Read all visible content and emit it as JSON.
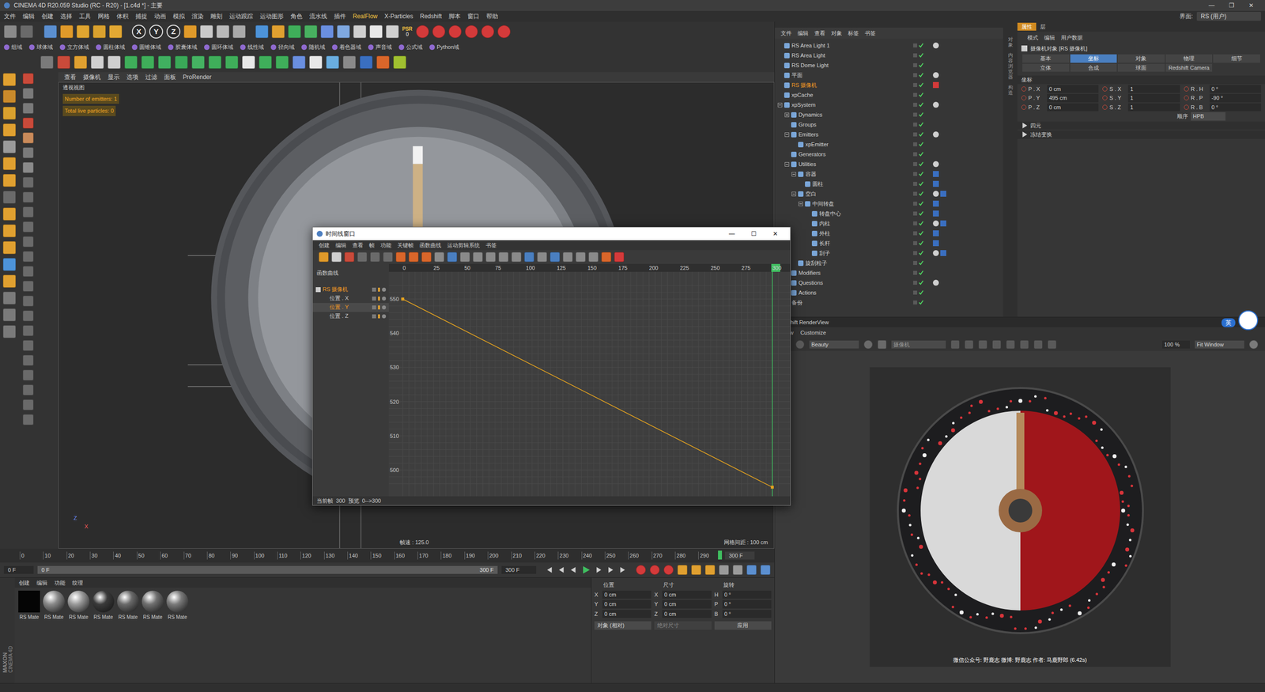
{
  "window": {
    "title": "CINEMA 4D R20.059 Studio (RC - R20) - [1.c4d *] - 主要",
    "controls": [
      "—",
      "❐",
      "✕"
    ]
  },
  "menu": [
    {
      "label": "文件",
      "highlighted": false
    },
    {
      "label": "编辑",
      "highlighted": false
    },
    {
      "label": "创建",
      "highlighted": false
    },
    {
      "label": "选择",
      "highlighted": false
    },
    {
      "label": "工具",
      "highlighted": false
    },
    {
      "label": "网格",
      "highlighted": false
    },
    {
      "label": "体积",
      "highlighted": false
    },
    {
      "label": "捕捉",
      "highlighted": false
    },
    {
      "label": "动画",
      "highlighted": false
    },
    {
      "label": "模拟",
      "highlighted": false
    },
    {
      "label": "渲染",
      "highlighted": false
    },
    {
      "label": "雕刻",
      "highlighted": false
    },
    {
      "label": "运动跟踪",
      "highlighted": false
    },
    {
      "label": "运动图形",
      "highlighted": false
    },
    {
      "label": "角色",
      "highlighted": false
    },
    {
      "label": "流水线",
      "highlighted": false
    },
    {
      "label": "插件",
      "highlighted": false
    },
    {
      "label": "RealFlow",
      "highlighted": true
    },
    {
      "label": "X-Particles",
      "highlighted": false
    },
    {
      "label": "Redshift",
      "highlighted": false
    },
    {
      "label": "脚本",
      "highlighted": false
    },
    {
      "label": "窗口",
      "highlighted": false
    },
    {
      "label": "帮助",
      "highlighted": false
    }
  ],
  "layout": {
    "label": "界面:",
    "value": "RS (用户)"
  },
  "toolbar": {
    "axes": [
      "X",
      "Y",
      "Z"
    ],
    "psr": {
      "label": "PSR",
      "value": "0"
    }
  },
  "fields": [
    "组域",
    "球体域",
    "立方体域",
    "圆柱体域",
    "圆锥体域",
    "胶囊体域",
    "圆环体域",
    "线性域",
    "径向域",
    "随机域",
    "着色器域",
    "声音域",
    "公式域",
    "Python域"
  ],
  "viewport": {
    "menu": [
      "查看",
      "摄像机",
      "显示",
      "选项",
      "过滤",
      "面板",
      "ProRender"
    ],
    "label": "透视视图",
    "overlay": [
      "Number of emitters: 1",
      "Total live particles: 0"
    ],
    "fps": "帧速 : 125.0",
    "grid": "网格间距 : 100 cm",
    "axes": [
      "Z",
      "X"
    ]
  },
  "timeline": {
    "ticks": [
      "0",
      "10",
      "20",
      "30",
      "40",
      "50",
      "60",
      "70",
      "80",
      "90",
      "100",
      "110",
      "120",
      "130",
      "140",
      "150",
      "160",
      "170",
      "180",
      "190",
      "200",
      "210",
      "220",
      "230",
      "240",
      "250",
      "260",
      "270",
      "280",
      "290"
    ],
    "end": "300 F",
    "level": 1,
    "start_field": "0 F",
    "slider_start": "0 F",
    "slider_end": "300 F",
    "end_field": "300 F"
  },
  "materials": {
    "menu": [
      "创建",
      "编辑",
      "功能",
      "纹理"
    ],
    "items": [
      {
        "name": "RS Mate",
        "color": "#050505"
      },
      {
        "name": "RS Mate",
        "color": "#8a8a8a"
      },
      {
        "name": "RS Mate",
        "color": "#9a9a9a"
      },
      {
        "name": "RS Mate",
        "color": "#3a3a3a"
      },
      {
        "name": "RS Mate",
        "color": "#6a6a6a"
      },
      {
        "name": "RS Mate",
        "color": "#707070"
      },
      {
        "name": "RS Mate",
        "color": "#7a7a7a"
      }
    ]
  },
  "logo": [
    "MAXON",
    "CINEMA 4D"
  ],
  "coordinates": {
    "headers": [
      "位置",
      "尺寸",
      "旋转"
    ],
    "rows": [
      {
        "pos_axis": "X",
        "pos": "0 cm",
        "size_axis": "X",
        "size": "0 cm",
        "rot_axis": "H",
        "rot": "0 °"
      },
      {
        "pos_axis": "Y",
        "pos": "0 cm",
        "size_axis": "Y",
        "size": "0 cm",
        "rot_axis": "P",
        "rot": "0 °"
      },
      {
        "pos_axis": "Z",
        "pos": "0 cm",
        "size_axis": "Z",
        "size": "0 cm",
        "rot_axis": "B",
        "rot": "0 °"
      }
    ],
    "mode": "对象 (相对)",
    "size_mode": "绝对尺寸",
    "apply": "应用"
  },
  "object_manager": {
    "menu": [
      "文件",
      "编辑",
      "查看",
      "对象",
      "标签",
      "书签"
    ],
    "objects": [
      {
        "name": "RS Area Light 1",
        "depth": 0,
        "expander": "none",
        "selected": false
      },
      {
        "name": "RS Area Light",
        "depth": 0,
        "expander": "none",
        "selected": false
      },
      {
        "name": "RS Dome Light",
        "depth": 0,
        "expander": "none",
        "selected": false
      },
      {
        "name": "平面",
        "depth": 0,
        "expander": "none",
        "selected": false
      },
      {
        "name": "RS 摄像机",
        "depth": 0,
        "expander": "none",
        "selected": true
      },
      {
        "name": "xpCache",
        "depth": 0,
        "expander": "none",
        "selected": false
      },
      {
        "name": "xpSystem",
        "depth": 0,
        "expander": "open",
        "selected": false
      },
      {
        "name": "Dynamics",
        "depth": 1,
        "expander": "closed",
        "selected": false
      },
      {
        "name": "Groups",
        "depth": 1,
        "expander": "none",
        "selected": false
      },
      {
        "name": "Emitters",
        "depth": 1,
        "expander": "open",
        "selected": false
      },
      {
        "name": "xpEmitter",
        "depth": 2,
        "expander": "none",
        "selected": false
      },
      {
        "name": "Generators",
        "depth": 1,
        "expander": "none",
        "selected": false
      },
      {
        "name": "Utilities",
        "depth": 1,
        "expander": "open",
        "selected": false
      },
      {
        "name": "容器",
        "depth": 2,
        "expander": "open",
        "selected": false
      },
      {
        "name": "圆柱",
        "depth": 3,
        "expander": "none",
        "selected": false
      },
      {
        "name": "空白",
        "depth": 2,
        "expander": "open",
        "selected": false
      },
      {
        "name": "中间转盘",
        "depth": 3,
        "expander": "open",
        "selected": false
      },
      {
        "name": "转盘中心",
        "depth": 4,
        "expander": "none",
        "selected": false
      },
      {
        "name": "内柱",
        "depth": 4,
        "expander": "none",
        "selected": false
      },
      {
        "name": "外柱",
        "depth": 4,
        "expander": "none",
        "selected": false
      },
      {
        "name": "长杆",
        "depth": 4,
        "expander": "none",
        "selected": false
      },
      {
        "name": "刮子",
        "depth": 4,
        "expander": "none",
        "selected": false
      },
      {
        "name": "旋刮粒子",
        "depth": 2,
        "expander": "none",
        "selected": false
      },
      {
        "name": "Modifiers",
        "depth": 1,
        "expander": "closed",
        "selected": false
      },
      {
        "name": "Questions",
        "depth": 1,
        "expander": "closed",
        "selected": false
      },
      {
        "name": "Actions",
        "depth": 1,
        "expander": "closed",
        "selected": false
      },
      {
        "name": "备份",
        "depth": 0,
        "expander": "none",
        "selected": false
      }
    ]
  },
  "side_tabs": [
    "对象",
    "内容浏览器",
    "构造"
  ],
  "attributes": {
    "tabs": [
      {
        "label": "属性",
        "selected": true
      },
      {
        "label": "层",
        "selected": false
      }
    ],
    "menu": [
      "模式",
      "编辑",
      "用户数据"
    ],
    "title": "摄像机对象 [RS 摄像机]",
    "pages": [
      {
        "label": "基本",
        "selected": false
      },
      {
        "label": "坐标",
        "selected": true
      },
      {
        "label": "对象",
        "selected": false
      },
      {
        "label": "物理",
        "selected": false
      },
      {
        "label": "细节",
        "selected": false
      },
      {
        "label": "立体",
        "selected": false
      },
      {
        "label": "合成",
        "selected": false
      },
      {
        "label": "球面",
        "selected": false
      },
      {
        "label": "Redshift Camera",
        "selected": false
      }
    ],
    "section": "坐标",
    "fields": [
      [
        {
          "label": "P . X",
          "value": "0 cm"
        },
        {
          "label": "S . X",
          "value": "1"
        },
        {
          "label": "R . H",
          "value": "0 °"
        }
      ],
      [
        {
          "label": "P . Y",
          "value": "495 cm"
        },
        {
          "label": "S . Y",
          "value": "1"
        },
        {
          "label": "R . P",
          "value": "-90 °"
        }
      ],
      [
        {
          "label": "P . Z",
          "value": "0 cm"
        },
        {
          "label": "S . Z",
          "value": "1"
        },
        {
          "label": "R . B",
          "value": "0 °"
        }
      ]
    ],
    "order": {
      "label": "顺序",
      "value": "HPB"
    },
    "groups": [
      "四元",
      "冻结变换"
    ]
  },
  "render_view": {
    "title": "Redshift RenderView",
    "menu": [
      "View",
      "Customize"
    ],
    "aov": "Beauty",
    "camera": "摄像机",
    "zoom": "100 %",
    "fit": "Fit Window",
    "caption": "微信公众号: 野鹿志  微博: 野鹿志  作者: 马鹿野郎  (6.42s)",
    "ime": "英"
  },
  "timeline_window": {
    "title": "时间线窗口",
    "controls": [
      "—",
      "☐",
      "✕"
    ],
    "menu": [
      "创建",
      "编辑",
      "查看",
      "帧",
      "功能",
      "关键帧",
      "函数曲线",
      "运动剪辑系统",
      "书签"
    ],
    "panel": "函数曲线",
    "tracks": [
      {
        "name": "RS 摄像机",
        "kind": "object",
        "selected": false
      },
      {
        "name": "位置 . X",
        "kind": "track",
        "selected": false
      },
      {
        "name": "位置 . Y",
        "kind": "track",
        "selected": true
      },
      {
        "name": "位置 . Z",
        "kind": "track",
        "selected": false
      }
    ],
    "frame_ticks": [
      "0",
      "25",
      "50",
      "75",
      "100",
      "125",
      "150",
      "175",
      "200",
      "225",
      "250",
      "275",
      "300"
    ],
    "value_ticks": [
      "550",
      "540",
      "530",
      "520",
      "510",
      "500"
    ],
    "playhead_frame": 300,
    "series": [
      {
        "name": "位置 . Y",
        "frames": [
          0,
          300
        ],
        "values": [
          550,
          495
        ],
        "color": "#e0a020"
      }
    ],
    "status": "当前帧  300  预览  0-->300"
  }
}
